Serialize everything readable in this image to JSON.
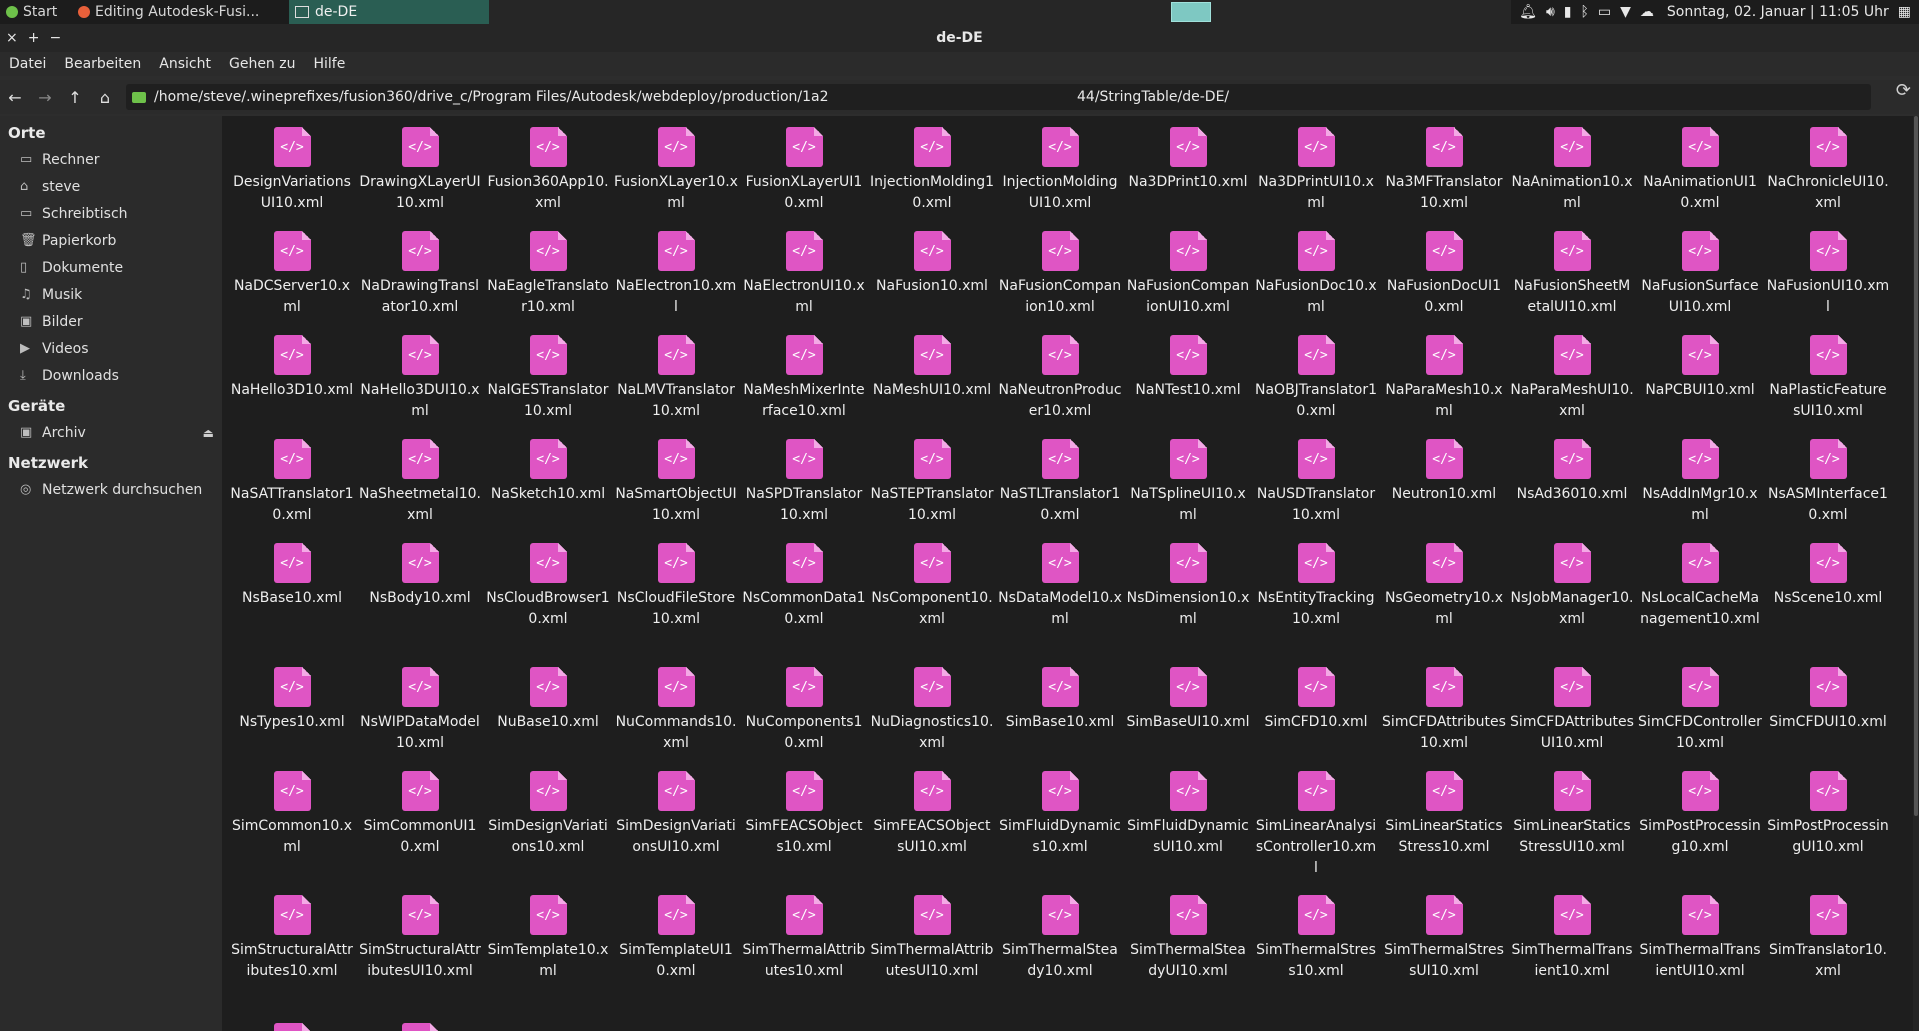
{
  "taskbar": {
    "start_label": "Start",
    "firefox_label": "Editing Autodesk-Fusi...",
    "folder_label": "de-DE",
    "datetime": "Sonntag, 02. Januar | 11:05 Uhr",
    "accent": "#2a5e53"
  },
  "window": {
    "title": "de-DE",
    "close": "×",
    "maximize": "+",
    "minimize": "−"
  },
  "menu": [
    "Datei",
    "Bearbeiten",
    "Ansicht",
    "Gehen zu",
    "Hilfe"
  ],
  "location": {
    "path_part1": "/home/steve/.wineprefixes/fusion360/drive_c/Program Files/Autodesk/webdeploy/production/1a2",
    "path_part2": "44/StringTable/de-DE/"
  },
  "sidebar": {
    "places_title": "Orte",
    "places": [
      {
        "label": "Rechner",
        "icon": "computer-icon"
      },
      {
        "label": "steve",
        "icon": "home-icon"
      },
      {
        "label": "Schreibtisch",
        "icon": "desktop-icon"
      },
      {
        "label": "Papierkorb",
        "icon": "trash-icon"
      },
      {
        "label": "Dokumente",
        "icon": "document-icon"
      },
      {
        "label": "Musik",
        "icon": "music-icon"
      },
      {
        "label": "Bilder",
        "icon": "image-icon"
      },
      {
        "label": "Videos",
        "icon": "video-icon"
      },
      {
        "label": "Downloads",
        "icon": "download-icon"
      }
    ],
    "devices_title": "Geräte",
    "devices": [
      {
        "label": "Archiv",
        "icon": "drive-icon"
      }
    ],
    "network_title": "Netzwerk",
    "network": [
      {
        "label": "Netzwerk durchsuchen",
        "icon": "network-icon"
      }
    ]
  },
  "file_icon": {
    "glyph": "</>",
    "color": "#df55c4"
  },
  "files": [
    [
      "DesignVariationsUI10.xml",
      "DrawingXLayerUI10.xml",
      "Fusion360App10.xml",
      "FusionXLayer10.xml",
      "FusionXLayerUI10.xml",
      "InjectionMolding10.xml",
      "InjectionMoldingUI10.xml",
      "Na3DPrint10.xml",
      "Na3DPrintUI10.xml",
      "Na3MFTranslator10.xml",
      "NaAnimation10.xml",
      "NaAnimationUI10.xml",
      "NaChronicleUI10.xml"
    ],
    [
      "NaDCServer10.xml",
      "NaDrawingTranslator10.xml",
      "NaEagleTranslator10.xml",
      "NaElectron10.xml",
      "NaElectronUI10.xml",
      "NaFusion10.xml",
      "NaFusionCompanion10.xml",
      "NaFusionCompanionUI10.xml",
      "NaFusionDoc10.xml",
      "NaFusionDocUI10.xml",
      "NaFusionSheetMetalUI10.xml",
      "NaFusionSurfaceUI10.xml",
      "NaFusionUI10.xml"
    ],
    [
      "NaHello3D10.xml",
      "NaHello3DUI10.xml",
      "NaIGESTranslator10.xml",
      "NaLMVTranslator10.xml",
      "NaMeshMixerInterface10.xml",
      "NaMeshUI10.xml",
      "NaNeutronProducer10.xml",
      "NaNTest10.xml",
      "NaOBJTranslator10.xml",
      "NaParaMesh10.xml",
      "NaParaMeshUI10.xml",
      "NaPCBUI10.xml",
      "NaPlasticFeaturesUI10.xml"
    ],
    [
      "NaSATTranslator10.xml",
      "NaSheetmetal10.xml",
      "NaSketch10.xml",
      "NaSmartObjectUI10.xml",
      "NaSPDTranslator10.xml",
      "NaSTEPTranslator10.xml",
      "NaSTLTranslator10.xml",
      "NaTSplineUI10.xml",
      "NaUSDTranslator10.xml",
      "Neutron10.xml",
      "NsAd36010.xml",
      "NsAddInMgr10.xml",
      "NsASMInterface10.xml"
    ],
    [
      "NsBase10.xml",
      "NsBody10.xml",
      "NsCloudBrowser10.xml",
      "NsCloudFileStore10.xml",
      "NsCommonData10.xml",
      "NsComponent10.xml",
      "NsDataModel10.xml",
      "NsDimension10.xml",
      "NsEntityTracking10.xml",
      "NsGeometry10.xml",
      "NsJobManager10.xml",
      "NsLocalCacheManagement10.xml",
      "NsScene10.xml"
    ],
    [
      "NsTypes10.xml",
      "NsWIPDataModel10.xml",
      "NuBase10.xml",
      "NuCommands10.xml",
      "NuComponents10.xml",
      "NuDiagnostics10.xml",
      "SimBase10.xml",
      "SimBaseUI10.xml",
      "SimCFD10.xml",
      "SimCFDAttributes10.xml",
      "SimCFDAttributesUI10.xml",
      "SimCFDController10.xml",
      "SimCFDUI10.xml"
    ],
    [
      "SimCommon10.xml",
      "SimCommonUI10.xml",
      "SimDesignVariations10.xml",
      "SimDesignVariationsUI10.xml",
      "SimFEACSObjects10.xml",
      "SimFEACSObjectsUI10.xml",
      "SimFluidDynamics10.xml",
      "SimFluidDynamicsUI10.xml",
      "SimLinearAnalysisController10.xml",
      "SimLinearStaticsStress10.xml",
      "SimLinearStaticsStressUI10.xml",
      "SimPostProcessing10.xml",
      "SimPostProcessingUI10.xml"
    ],
    [
      "SimStructuralAttributes10.xml",
      "SimStructuralAttributesUI10.xml",
      "SimTemplate10.xml",
      "SimTemplateUI10.xml",
      "SimThermalAttributes10.xml",
      "SimThermalAttributesUI10.xml",
      "SimThermalSteady10.xml",
      "SimThermalSteadyUI10.xml",
      "SimThermalStress10.xml",
      "SimThermalStressUI10.xml",
      "SimThermalTransient10.xml",
      "SimThermalTransientUI10.xml",
      "SimTranslator10.xml"
    ],
    [
      "",
      ""
    ]
  ]
}
